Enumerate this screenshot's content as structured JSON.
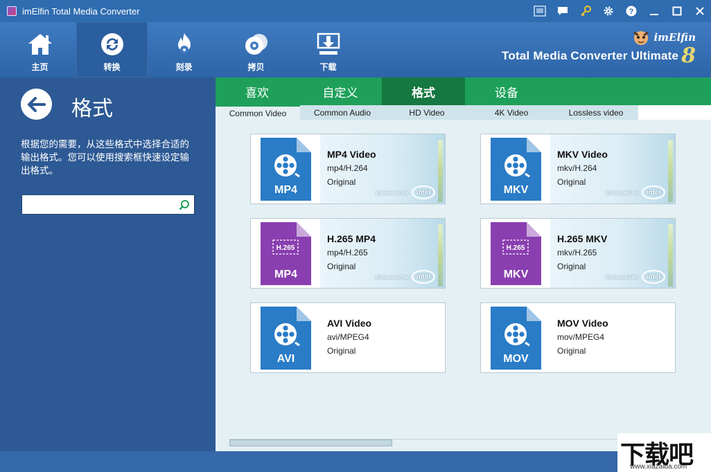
{
  "window": {
    "title": "imElfin Total Media Converter",
    "controls": [
      "screenshot-icon",
      "chat-icon",
      "key-icon",
      "gear-icon",
      "help-icon",
      "minimize-icon",
      "maximize-icon",
      "close-icon"
    ]
  },
  "toolbar": {
    "items": [
      {
        "label": "主页",
        "icon": "home-icon"
      },
      {
        "label": "转换",
        "icon": "convert-icon",
        "active": true
      },
      {
        "label": "刻录",
        "icon": "burn-icon"
      },
      {
        "label": "拷贝",
        "icon": "copy-disc-icon"
      },
      {
        "label": "下载",
        "icon": "download-icon"
      }
    ]
  },
  "brand": {
    "logo_text": "imElfin",
    "product_name": "Total Media Converter Ultimate",
    "version": "8"
  },
  "left_panel": {
    "title": "格式",
    "description": "根据您的需要，从这些格式中选择合适的输出格式。您可以使用搜索框快速设定输出格式。",
    "search": {
      "value": "",
      "placeholder": ""
    }
  },
  "category_tabs": [
    {
      "label": "喜欢"
    },
    {
      "label": "自定义"
    },
    {
      "label": "格式",
      "active": true
    },
    {
      "label": "设备"
    }
  ],
  "sub_tabs": [
    {
      "label": "Common Video",
      "active": true
    },
    {
      "label": "Common Audio"
    },
    {
      "label": "HD Video"
    },
    {
      "label": "4K Video"
    },
    {
      "label": "Lossless video"
    }
  ],
  "formats": [
    {
      "name": "MP4 Video",
      "codec": "mp4/H.264",
      "quality": "Original",
      "badge": "MP4",
      "icon_color": "#2a7cc7",
      "h265": false,
      "intel": true
    },
    {
      "name": "MKV Video",
      "codec": "mkv/H.264",
      "quality": "Original",
      "badge": "MKV",
      "icon_color": "#2a7cc7",
      "h265": false,
      "intel": true
    },
    {
      "name": "H.265 MP4",
      "codec": "mp4/H.265",
      "quality": "Original",
      "badge": "MP4",
      "icon_color": "#8a3fb0",
      "h265": true,
      "intel": true
    },
    {
      "name": "H.265 MKV",
      "codec": "mkv/H.265",
      "quality": "Original",
      "badge": "MKV",
      "icon_color": "#8a3fb0",
      "h265": true,
      "intel": true
    },
    {
      "name": "AVI Video",
      "codec": "avi/MPEG4",
      "quality": "Original",
      "badge": "AVI",
      "icon_color": "#2a7cc7",
      "h265": false,
      "intel": false
    },
    {
      "name": "MOV Video",
      "codec": "mov/MPEG4",
      "quality": "Original",
      "badge": "MOV",
      "icon_color": "#2a7cc7",
      "h265": false,
      "intel": false
    }
  ],
  "intel_badge": {
    "enhanced_text": "Enhanced for",
    "brand": "intel"
  },
  "h265_label": "H.265",
  "watermark": {
    "big": "下载吧",
    "small": "www.xiazaiba.com"
  }
}
